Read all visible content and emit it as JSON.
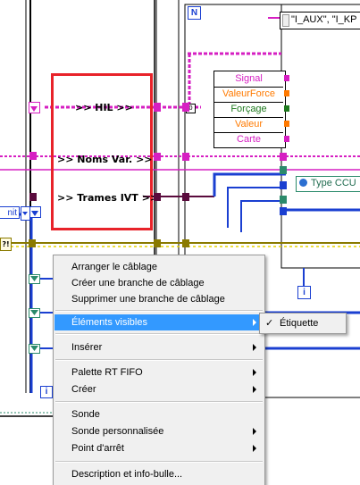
{
  "diagram": {
    "wire_labels": {
      "hil": ">> HIL >>",
      "noms_var": ">> Noms Var. >>",
      "trames_ivt": ">> Trames IVT >>"
    },
    "loop_index_glyph": "N",
    "iteration_glyph": "i",
    "left_control_text": "nit",
    "error_glyph": "?!",
    "string_array_const": "\"I_AUX\", \"I_KP",
    "type_ccu_label": "Type CCU",
    "unbundle_rows": [
      "Signal",
      "ValeurForce",
      "Forçage",
      "Valeur",
      "Carte"
    ],
    "colors": {
      "pink_wire": "#d61fc2",
      "blue_wire": "#1a3fd1",
      "olive_wire": "#8a7a00",
      "green_wire": "#2b8a6b",
      "orange_term": "#ff7a00",
      "red_highlight": "#e8232a"
    }
  },
  "context_menu": {
    "groups": [
      [
        "Arranger le câblage",
        "Créer une branche de câblage",
        "Supprimer une branche de câblage"
      ],
      [
        "Éléments visibles"
      ],
      [
        "Insérer"
      ],
      [
        "Palette RT FIFO",
        "Créer"
      ],
      [
        "Sonde",
        "Sonde personnalisée",
        "Point d'arrêt"
      ],
      [
        "Description et info-bulle..."
      ]
    ],
    "submenu_items": [
      {
        "label": "Étiquette",
        "checked": true
      }
    ],
    "check_glyph": "✓"
  }
}
